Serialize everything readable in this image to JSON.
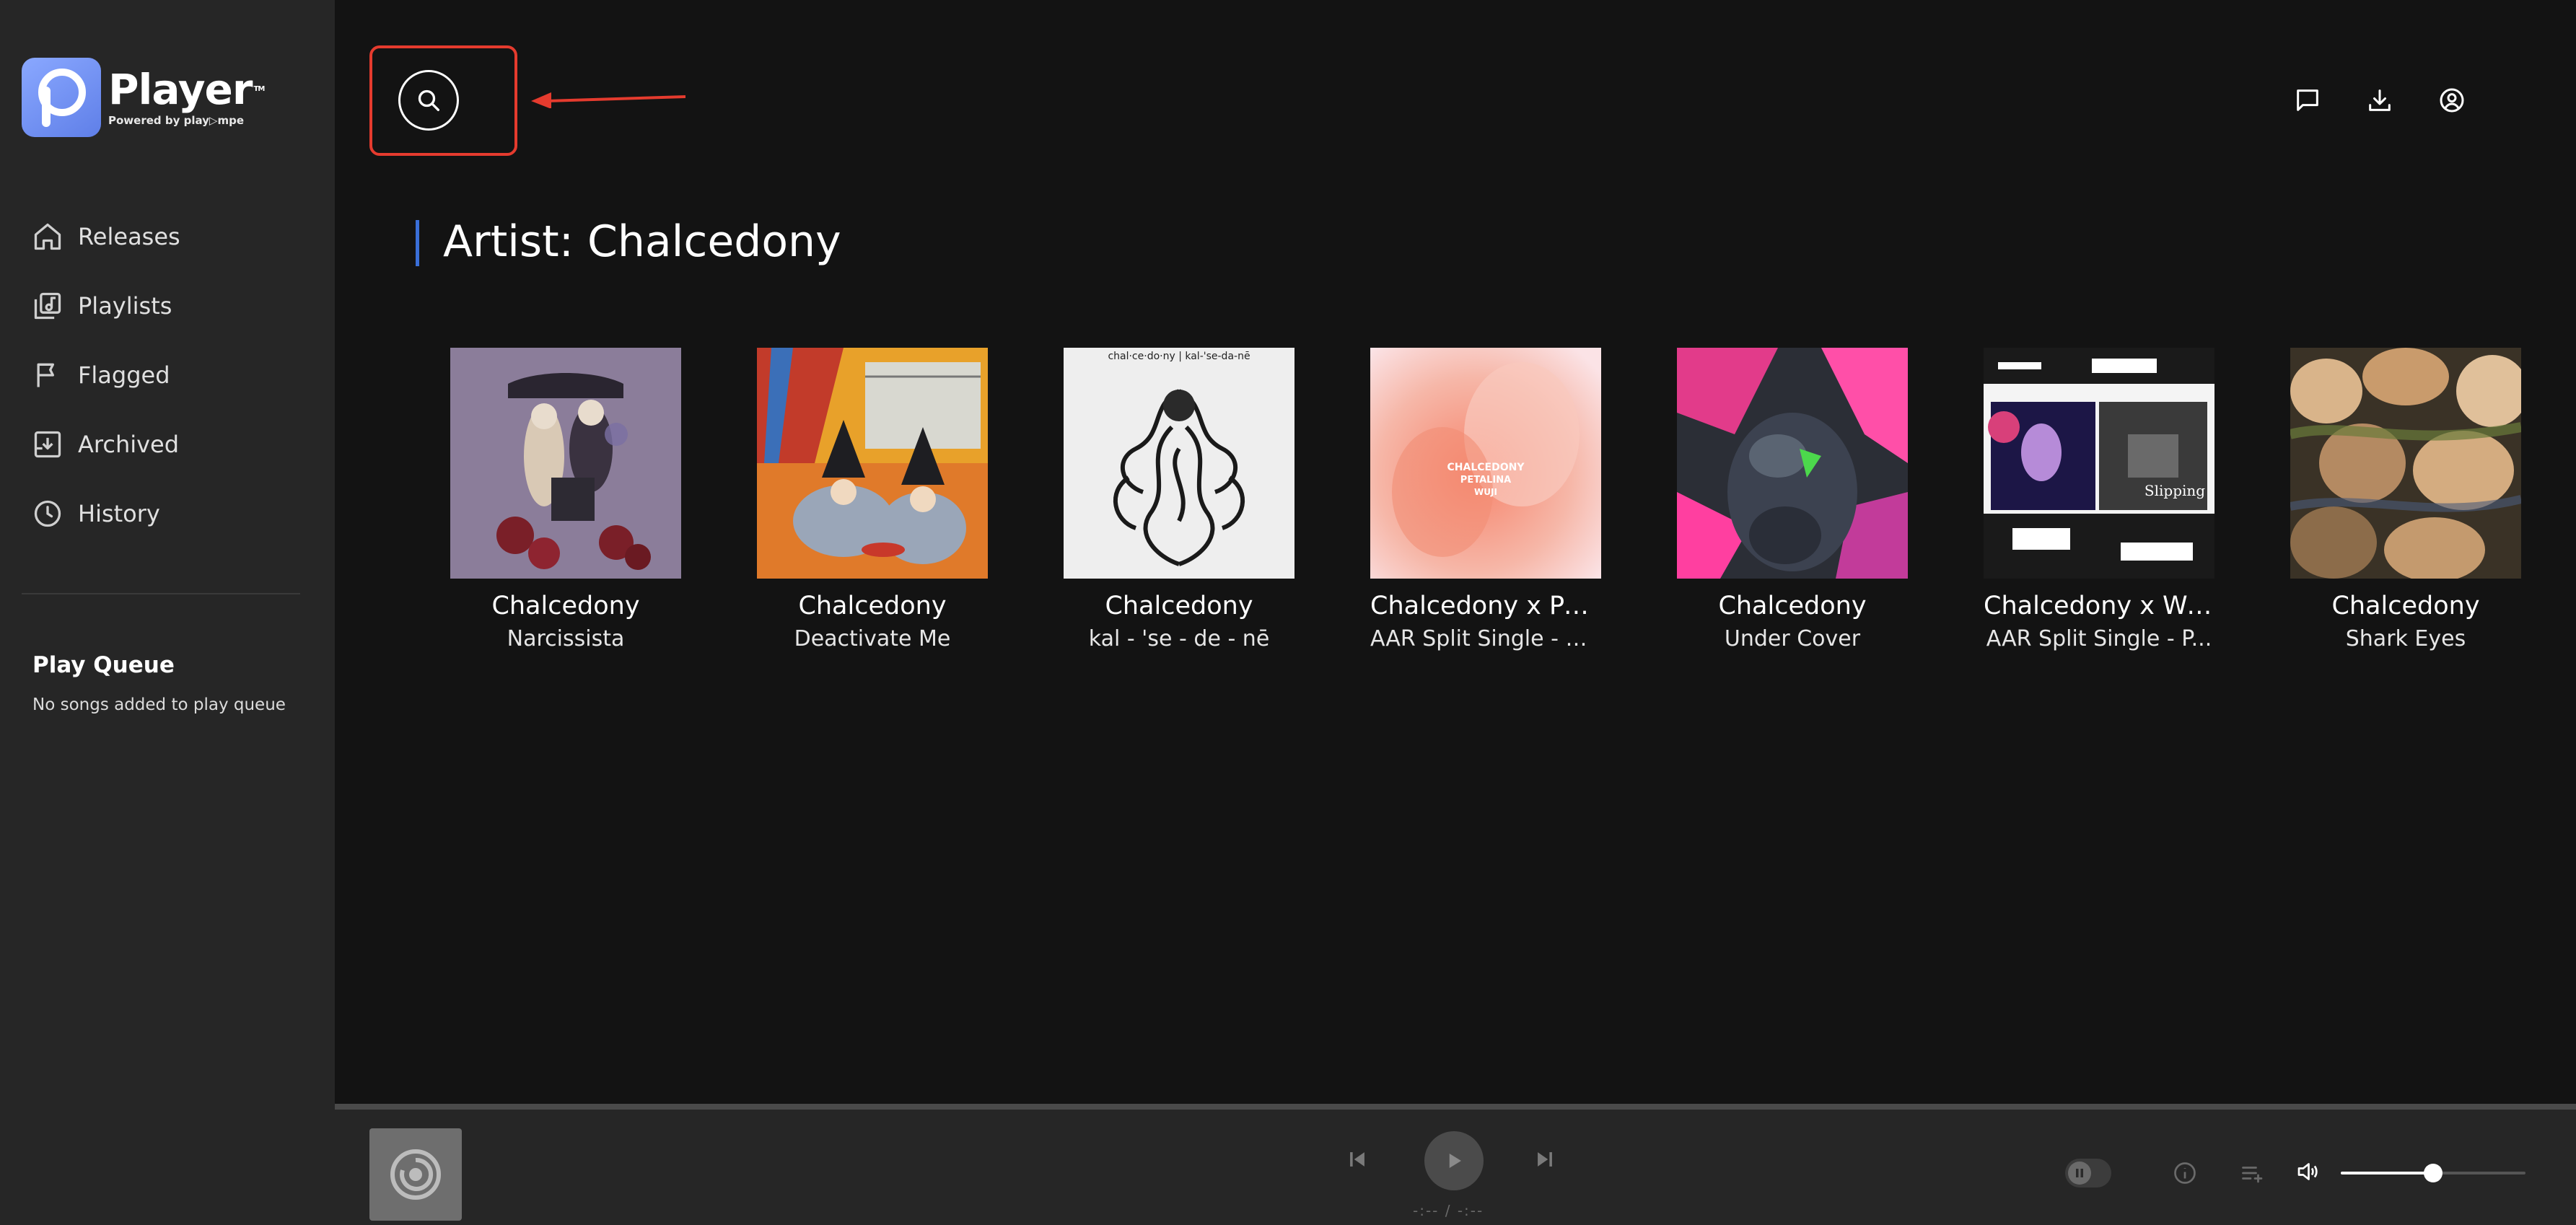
{
  "app": {
    "name": "Player",
    "tagline": "Powered by play▷mpe"
  },
  "sidebar": {
    "items": [
      {
        "label": "Releases",
        "icon": "home-icon"
      },
      {
        "label": "Playlists",
        "icon": "playlist-icon"
      },
      {
        "label": "Flagged",
        "icon": "flag-icon"
      },
      {
        "label": "Archived",
        "icon": "archive-icon"
      },
      {
        "label": "History",
        "icon": "clock-icon"
      }
    ],
    "queue_title": "Play Queue",
    "queue_empty": "No songs added to play queue"
  },
  "header": {
    "actions": [
      "message-icon",
      "download-icon",
      "account-icon"
    ]
  },
  "main": {
    "title": "Artist: Chalcedony",
    "releases": [
      {
        "artist": "Chalcedony",
        "title": "Narcissista"
      },
      {
        "artist": "Chalcedony",
        "title": "Deactivate Me"
      },
      {
        "artist": "Chalcedony",
        "title": "kal - 'se - de - nē"
      },
      {
        "artist": "Chalcedony x Pet...",
        "title": "AAR Split Single - D..."
      },
      {
        "artist": "Chalcedony",
        "title": "Under Cover"
      },
      {
        "artist": "Chalcedony x Wuji",
        "title": "AAR Split Single - P..."
      },
      {
        "artist": "Chalcedony",
        "title": "Shark Eyes"
      }
    ]
  },
  "player": {
    "time": "-:-- / -:--",
    "volume": 0.5
  },
  "colors": {
    "accent": "#3a6fd8",
    "annotation": "#e53b2e",
    "sidebar_bg": "#262626",
    "main_bg": "#131313"
  }
}
